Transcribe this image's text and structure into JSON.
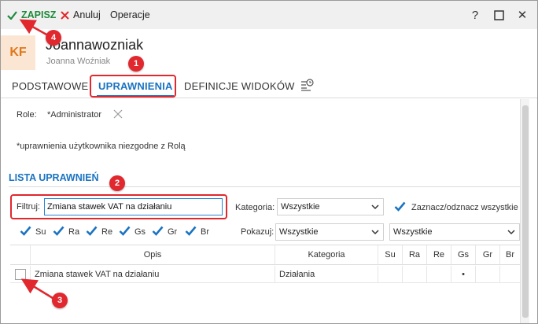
{
  "toolbar": {
    "save_label": "ZAPISZ",
    "cancel_label": "Anuluj",
    "operations_label": "Operacje",
    "help_label": "?",
    "close_label": "✕"
  },
  "header": {
    "avatar_initials": "KF",
    "login": "Joannawozniak",
    "full_name": "Joanna Woźniak"
  },
  "tabs": [
    {
      "label": "PODSTAWOWE"
    },
    {
      "label": "UPRAWNIENIA",
      "active": true
    },
    {
      "label": "DEFINICJE WIDOKÓW"
    }
  ],
  "role": {
    "label": "Role:",
    "value": "*Administrator"
  },
  "note": "*uprawnienia użytkownika niezgodne z Rolą",
  "section_title": "LISTA UPRAWNIEŃ",
  "filter": {
    "label": "Filtruj:",
    "value": "Zmiana stawek VAT na działaniu"
  },
  "category": {
    "label": "Kategoria:",
    "value": "Wszystkie"
  },
  "select_all_label": "Zaznacz/odznacz wszystkie",
  "permission_checks": [
    {
      "label": "Su",
      "checked": true
    },
    {
      "label": "Ra",
      "checked": true
    },
    {
      "label": "Re",
      "checked": true
    },
    {
      "label": "Gs",
      "checked": true
    },
    {
      "label": "Gr",
      "checked": true
    },
    {
      "label": "Br",
      "checked": true
    }
  ],
  "show": {
    "label": "Pokazuj:",
    "value": "Wszystkie",
    "value2": "Wszystkie"
  },
  "table": {
    "columns": [
      "Opis",
      "Kategoria",
      "Su",
      "Ra",
      "Re",
      "Gs",
      "Gr",
      "Br"
    ],
    "rows": [
      {
        "opis": "Zmiana stawek VAT na działaniu",
        "kategoria": "Działania",
        "su": "",
        "ra": "",
        "re": "",
        "gs": "•",
        "gr": "",
        "br": ""
      }
    ]
  },
  "annotations": [
    "1",
    "2",
    "3",
    "4"
  ],
  "colors": {
    "accent": "#1a73c2",
    "save_green": "#1d8a3a",
    "annotation_red": "#e0282e",
    "avatar_bg": "#fbe6d3",
    "avatar_fg": "#e0781c"
  }
}
